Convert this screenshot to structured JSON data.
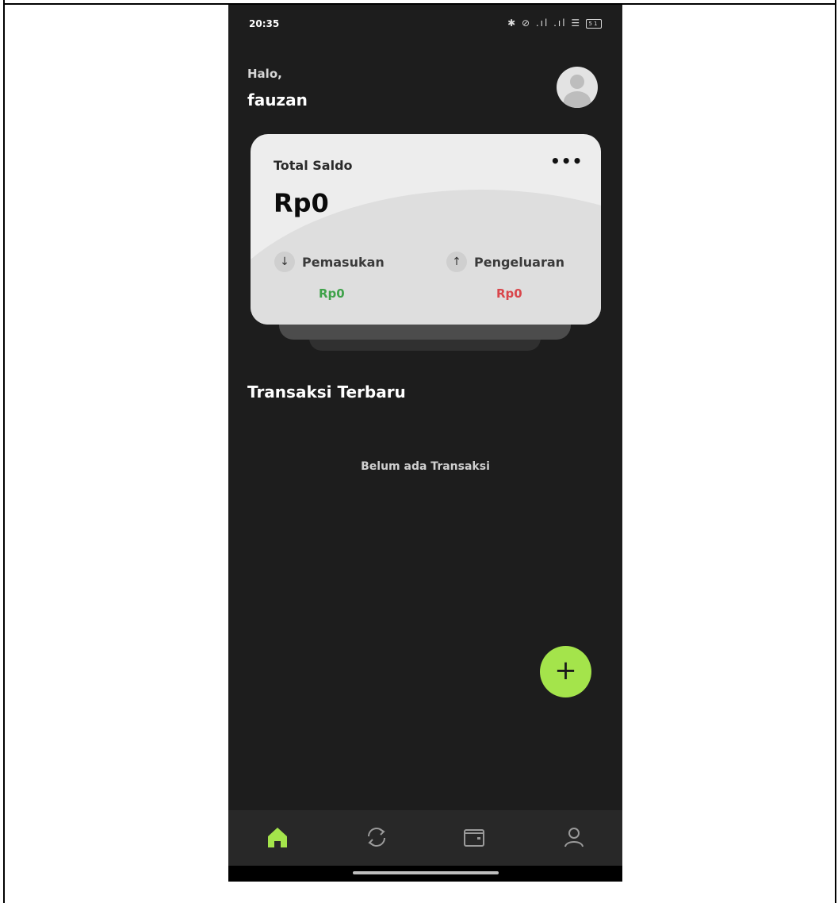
{
  "status_bar": {
    "time": "20:35",
    "icons": "✱ ⊘ .ıl .ıl ☰",
    "battery": "51"
  },
  "header": {
    "greeting": "Halo,",
    "username": "fauzan"
  },
  "balance_card": {
    "label": "Total Saldo",
    "more": "•••",
    "total": "Rp0",
    "income": {
      "label": "Pemasukan",
      "amount": "Rp0",
      "icon": "↓"
    },
    "expense": {
      "label": "Pengeluaran",
      "amount": "Rp0",
      "icon": "↑"
    }
  },
  "transactions": {
    "title": "Transaksi Terbaru",
    "empty_text": "Belum ada Transaksi"
  },
  "fab": {
    "label": "+"
  },
  "colors": {
    "accent": "#a4e44b",
    "income": "#3fa24a",
    "expense": "#d9464b",
    "background": "#1d1d1d"
  },
  "nav": {
    "items": [
      {
        "icon": "home-icon",
        "active": true
      },
      {
        "icon": "sync-icon",
        "active": false
      },
      {
        "icon": "wallet-icon",
        "active": false
      },
      {
        "icon": "profile-icon",
        "active": false
      }
    ]
  }
}
